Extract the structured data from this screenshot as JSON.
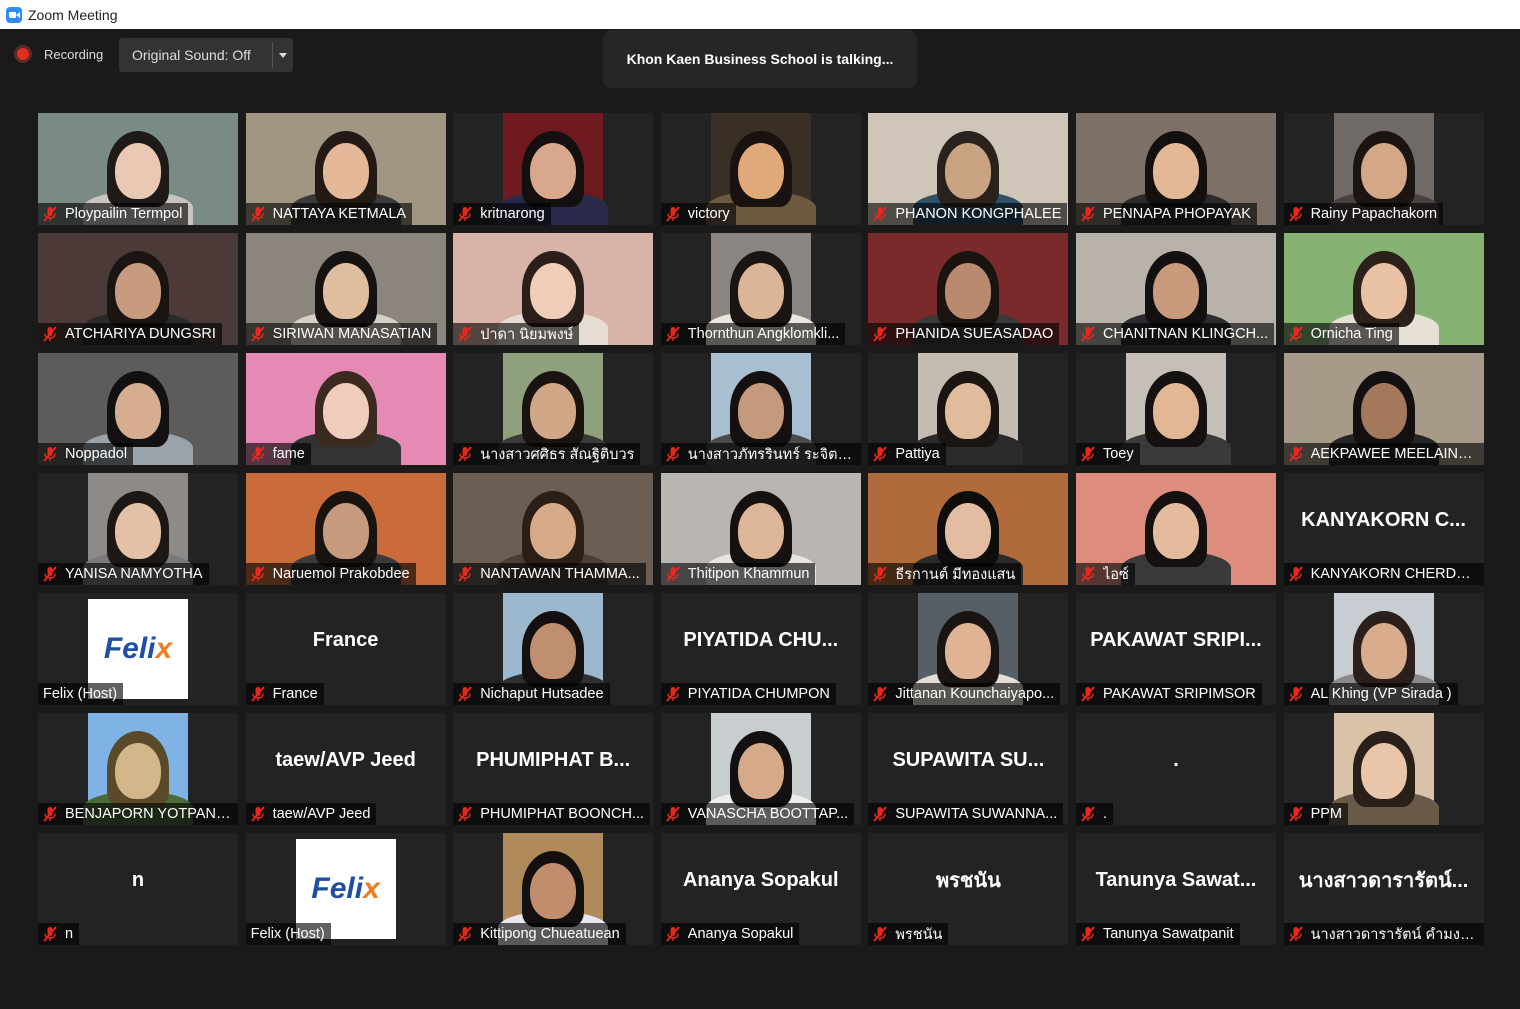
{
  "window": {
    "title": "Zoom Meeting"
  },
  "toolbar": {
    "recording_label": "Recording",
    "original_sound_label": "Original Sound: Off"
  },
  "active_speaker_text": "Khon Kaen Business School is talking...",
  "colors": {
    "mute": "#e8281e",
    "tile_bg": "#232323",
    "recording_dot": "#e0301e"
  },
  "participants": [
    {
      "label": "Ploypailin Termpol",
      "muted": true,
      "mode": "video",
      "bg": "#7a8a84",
      "skin": "#e9c9b4",
      "hair": "#1e1a18",
      "shirt": "#c9c4bf"
    },
    {
      "label": "NATTAYA KETMALA",
      "muted": true,
      "mode": "video",
      "bg": "#a19682",
      "skin": "#e6b89a",
      "hair": "#231a15",
      "shirt": "#3a3a3a"
    },
    {
      "label": "kritnarong",
      "muted": true,
      "mode": "video",
      "bg": "#6e1a1e",
      "skin": "#d9a78c",
      "hair": "#141010",
      "shirt": "#2a2a4a",
      "pillar": true
    },
    {
      "label": "victory",
      "muted": true,
      "mode": "video",
      "bg": "#3a2f24",
      "skin": "#e0a97a",
      "hair": "#1a1210",
      "shirt": "#6e5a3f",
      "pillar": true
    },
    {
      "label": "PHANON KONGPHALEE",
      "muted": true,
      "mode": "video",
      "bg": "#cfc6b9",
      "skin": "#caa382",
      "hair": "#2a221c",
      "shirt": "#2f5066"
    },
    {
      "label": "PENNAPA PHOPAYAK",
      "muted": true,
      "mode": "video",
      "bg": "#7d7167",
      "skin": "#e3b897",
      "hair": "#141010",
      "shirt": "#2b2b2b"
    },
    {
      "label": "Rainy Papachakorn",
      "muted": true,
      "mode": "video",
      "bg": "#6f6a66",
      "skin": "#d4a887",
      "hair": "#1b1411",
      "shirt": "#4a4040",
      "pillar": true
    },
    {
      "label": "ATCHARIYA DUNGSRI",
      "muted": true,
      "mode": "video",
      "bg": "#4b3a37",
      "skin": "#c89a7e",
      "hair": "#1a1412",
      "shirt": "#2a2a2a"
    },
    {
      "label": "SIRIWAN MANASATIAN",
      "muted": true,
      "mode": "video",
      "bg": "#8b857e",
      "skin": "#e1bd9f",
      "hair": "#151211",
      "shirt": "#d8d0c6"
    },
    {
      "label": "ปาดา นิยมพงษ์",
      "muted": true,
      "mode": "video",
      "bg": "#d9b3a7",
      "skin": "#f0cdb8",
      "hair": "#2a1f1b",
      "shirt": "#e7dcd3"
    },
    {
      "label": "Thornthun Angklomkli...",
      "muted": true,
      "mode": "video",
      "bg": "#8a8580",
      "skin": "#dbb597",
      "hair": "#1a1412",
      "shirt": "#ece6de",
      "pillar": true
    },
    {
      "label": "PHANIDA SUEASADAO",
      "muted": true,
      "mode": "video",
      "bg": "#7a2a2a",
      "skin": "#b98a6d",
      "hair": "#1a1410",
      "shirt": "#3a3a3a"
    },
    {
      "label": "CHANITNAN KLINGCH...",
      "muted": true,
      "mode": "video",
      "bg": "#b8b2aa",
      "skin": "#c99a7c",
      "hair": "#121010",
      "shirt": "#2b2b30"
    },
    {
      "label": "Ornicha Ting",
      "muted": true,
      "mode": "video",
      "bg": "#86b373",
      "skin": "#e9c2a3",
      "hair": "#2c211a",
      "shirt": "#e6e0d7"
    },
    {
      "label": "Noppadol",
      "muted": true,
      "mode": "video",
      "bg": "#5d5c5a",
      "skin": "#d6ad90",
      "hair": "#121010",
      "shirt": "#9aa3aa"
    },
    {
      "label": "fame",
      "muted": true,
      "mode": "video",
      "bg": "#e58ab4",
      "skin": "#efccbb",
      "hair": "#3a2a20",
      "shirt": "#333333"
    },
    {
      "label": "นางสาวศศิธร สัณฐิติบวร",
      "muted": true,
      "mode": "video",
      "bg": "#8fa07c",
      "skin": "#d2a788",
      "hair": "#1a1410",
      "shirt": "#3a3a3a",
      "pillar": true
    },
    {
      "label": "นางสาวภัทรรินทร์ ระจิตด...",
      "muted": true,
      "mode": "video",
      "bg": "#a7bfd1",
      "skin": "#c59a7c",
      "hair": "#141010",
      "shirt": "#4a4a4a",
      "pillar": true
    },
    {
      "label": "Pattiya",
      "muted": true,
      "mode": "video",
      "bg": "#c4bcb0",
      "skin": "#e1bc9c",
      "hair": "#1b1512",
      "shirt": "#2b2b2b",
      "pillar": true
    },
    {
      "label": "Toey",
      "muted": true,
      "mode": "video",
      "bg": "#c5bfb7",
      "skin": "#e2b796",
      "hair": "#151110",
      "shirt": "#3a3a3a",
      "pillar": true
    },
    {
      "label": "AEKPAWEE MEELAING...",
      "muted": true,
      "mode": "video",
      "bg": "#a89a88",
      "skin": "#a3785c",
      "hair": "#121010",
      "shirt": "#262626"
    },
    {
      "label": "YANISA NAMYOTHA",
      "muted": true,
      "mode": "video",
      "bg": "#8e8a88",
      "skin": "#e4c1a6",
      "hair": "#1d1715",
      "shirt": "#7a7a7a",
      "pillar": true
    },
    {
      "label": "Naruemol Prakobdee",
      "muted": true,
      "mode": "video",
      "bg": "#c96b3a",
      "skin": "#c69a7c",
      "hair": "#1a1410",
      "shirt": "#3a3a3a"
    },
    {
      "label": "NANTAWAN THAMMA...",
      "muted": true,
      "mode": "video",
      "bg": "#6d5e54",
      "skin": "#d7ab8a",
      "hair": "#2a1e17",
      "shirt": "#4a3e38"
    },
    {
      "label": "Thitipon Khammun",
      "muted": true,
      "mode": "video",
      "bg": "#b9b6b2",
      "skin": "#ddb597",
      "hair": "#141110",
      "shirt": "#e8e4df"
    },
    {
      "label": "ธีรกานต์ มีทองแสน",
      "muted": true,
      "mode": "video",
      "bg": "#b06a3c",
      "skin": "#e3bda1",
      "hair": "#0f0d0c",
      "shirt": "#2b2b2b"
    },
    {
      "label": "ไอซ์",
      "muted": true,
      "mode": "video",
      "bg": "#de8c7e",
      "skin": "#e4bb9c",
      "hair": "#151110",
      "shirt": "#3a3a3a"
    },
    {
      "label": "KANYAKORN CHERDSRI",
      "muted": true,
      "mode": "name",
      "display": "KANYAKORN  C..."
    },
    {
      "label": "Felix (Host)",
      "muted": false,
      "mode": "logo",
      "logo_text": "Felix"
    },
    {
      "label": "France",
      "muted": true,
      "mode": "name",
      "display": "France"
    },
    {
      "label": "Nichaput Hutsadee",
      "muted": true,
      "mode": "video",
      "bg": "#9cb8cf",
      "skin": "#c08f70",
      "hair": "#141010",
      "shirt": "#2f2f2f",
      "pillar": true
    },
    {
      "label": "PIYATIDA CHUMPON",
      "muted": true,
      "mode": "name",
      "display": "PIYATIDA  CHU..."
    },
    {
      "label": "Jittanan Kounchaiyapo...",
      "muted": true,
      "mode": "video",
      "bg": "#565e66",
      "skin": "#dfb393",
      "hair": "#1a1412",
      "shirt": "#e3ddd5",
      "pillar": true
    },
    {
      "label": "PAKAWAT SRIPIMSOR",
      "muted": true,
      "mode": "name",
      "display": "PAKAWAT  SRIPI..."
    },
    {
      "label": "AL Khing (VP Sirada )",
      "muted": true,
      "mode": "video",
      "bg": "#c7cdd2",
      "skin": "#d8ac8c",
      "hair": "#2a1f1a",
      "shirt": "#8a8a8a",
      "pillar": true
    },
    {
      "label": "BENJAPORN YOTPANYA",
      "muted": true,
      "mode": "video",
      "bg": "#7fb3e6",
      "skin": "#d2b78a",
      "hair": "#5a4a2a",
      "shirt": "#4a6a3a",
      "pillar": true,
      "tower": true
    },
    {
      "label": "taew/AVP Jeed",
      "muted": true,
      "mode": "name",
      "display": "taew/AVP Jeed"
    },
    {
      "label": "PHUMIPHAT BOONCH...",
      "muted": true,
      "mode": "name",
      "display": "PHUMIPHAT  B..."
    },
    {
      "label": "VANASCHA BOOTTAP...",
      "muted": true,
      "mode": "video",
      "bg": "#c8cdd0",
      "skin": "#d5a98a",
      "hair": "#121010",
      "shirt": "#eeeeee",
      "pillar": true
    },
    {
      "label": "SUPAWITA  SUWANNA...",
      "muted": true,
      "mode": "name",
      "display": "SUPAWITA  SU..."
    },
    {
      "label": ".",
      "muted": true,
      "mode": "name",
      "display": "."
    },
    {
      "label": "PPM",
      "muted": true,
      "mode": "video",
      "bg": "#d9c2a8",
      "skin": "#e9c6aa",
      "hair": "#2a201a",
      "shirt": "#6a5a4a",
      "pillar": true
    },
    {
      "label": "n",
      "muted": true,
      "mode": "name",
      "display": "n"
    },
    {
      "label": "Felix (Host)",
      "muted": false,
      "mode": "logo",
      "logo_text": "Felix"
    },
    {
      "label": "Kittipong Chueatuean",
      "muted": true,
      "mode": "video",
      "bg": "#b08a5a",
      "skin": "#c08e6c",
      "hair": "#141010",
      "shirt": "#e8e8f0",
      "pillar": true
    },
    {
      "label": "Ananya Sopakul",
      "muted": true,
      "mode": "name",
      "display": "Ananya Sopakul"
    },
    {
      "label": "พรชนัน",
      "muted": true,
      "mode": "name",
      "display": "พรชนัน"
    },
    {
      "label": "Tanunya Sawatpanit",
      "muted": true,
      "mode": "name",
      "display": "Tanunya  Sawat..."
    },
    {
      "label": "นางสาวดารารัตน์ คำมงคล",
      "muted": true,
      "mode": "name",
      "display": "นางสาวดารารัตน์..."
    }
  ]
}
